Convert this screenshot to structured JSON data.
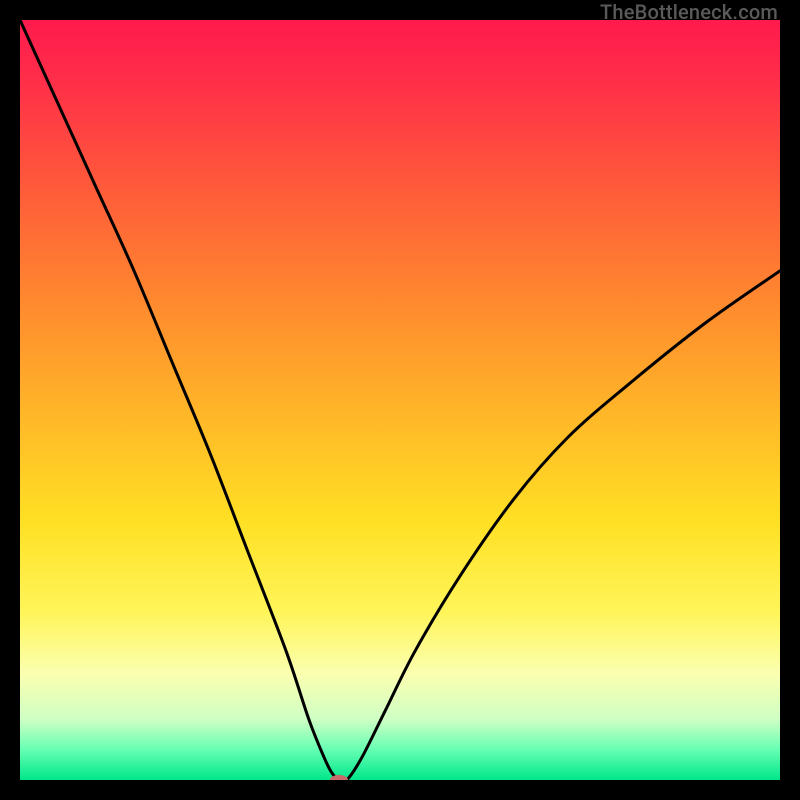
{
  "watermark": {
    "text": "TheBottleneck.com"
  },
  "colors": {
    "curve_stroke": "#000000",
    "marker_fill": "#c96a6a",
    "frame_bg": "#000000"
  },
  "chart_data": {
    "type": "line",
    "title": "",
    "xlabel": "",
    "ylabel": "",
    "xlim": [
      0,
      100
    ],
    "ylim": [
      0,
      100
    ],
    "grid": false,
    "legend": false,
    "series": [
      {
        "name": "curve",
        "x": [
          0,
          5,
          10,
          15,
          20,
          25,
          30,
          35,
          38,
          40,
          41,
          42,
          43,
          45,
          48,
          52,
          58,
          65,
          72,
          80,
          90,
          100
        ],
        "values": [
          100,
          89,
          78,
          67,
          55,
          43,
          30,
          17,
          8,
          3,
          1,
          0,
          0,
          3,
          9,
          17,
          27,
          37,
          45,
          52,
          60,
          67
        ]
      }
    ],
    "marker": {
      "x": 42,
      "y": 0,
      "shape": "pill"
    }
  }
}
